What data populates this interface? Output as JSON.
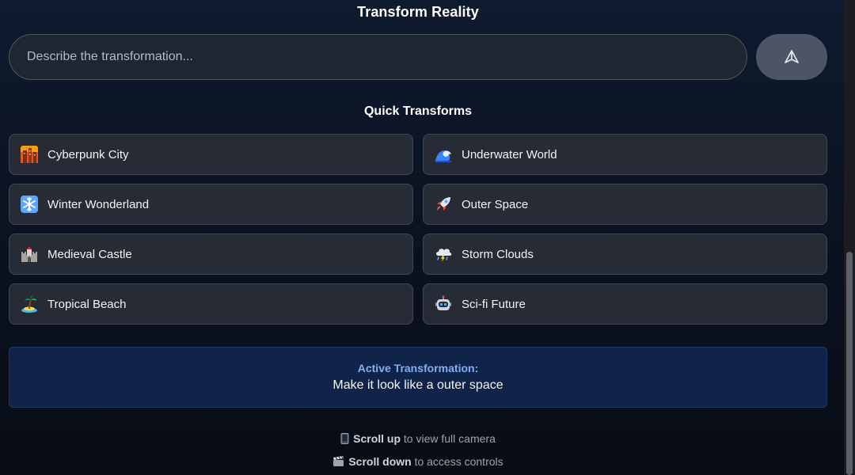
{
  "header": {
    "title": "Transform Reality"
  },
  "prompt": {
    "placeholder": "Describe the transformation...",
    "value": "",
    "send_icon": "send-triangle-icon"
  },
  "quick": {
    "title": "Quick Transforms",
    "items": [
      {
        "label": "Cyberpunk City",
        "icon": "cityscape-icon"
      },
      {
        "label": "Underwater World",
        "icon": "wave-icon"
      },
      {
        "label": "Winter Wonderland",
        "icon": "snowflake-icon"
      },
      {
        "label": "Outer Space",
        "icon": "rocket-icon"
      },
      {
        "label": "Medieval Castle",
        "icon": "castle-icon"
      },
      {
        "label": "Storm Clouds",
        "icon": "storm-cloud-icon"
      },
      {
        "label": "Tropical Beach",
        "icon": "island-icon"
      },
      {
        "label": "Sci-fi Future",
        "icon": "robot-icon"
      }
    ]
  },
  "active": {
    "label": "Active Transformation:",
    "value": "Make it look like a outer space"
  },
  "hints": {
    "scroll_up_bold": "Scroll up",
    "scroll_up_rest": "to view full camera",
    "scroll_up_icon": "phone-icon",
    "scroll_down_bold": "Scroll down",
    "scroll_down_rest": "to access controls",
    "scroll_down_icon": "clapperboard-icon"
  },
  "colors": {
    "background": "#0b1220",
    "button": "#262b35",
    "active_box": "#10244a",
    "active_label": "#7fb0f5"
  }
}
